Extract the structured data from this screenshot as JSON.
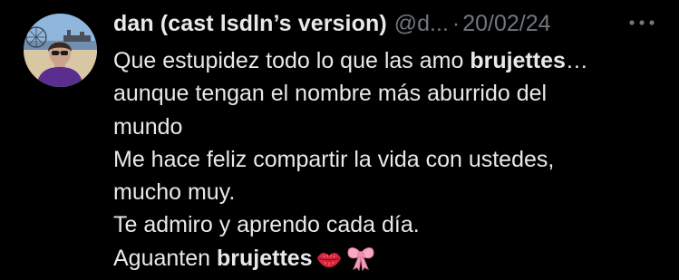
{
  "tweet": {
    "display_name": "dan (cast lsdln’s version)",
    "handle": "@d...",
    "separator": "·",
    "date": "20/02/24",
    "more_icon": "more-horizontal-icon",
    "avatar_icon": "profile-photo",
    "lines": [
      {
        "parts": [
          {
            "text": "Que estupidez todo lo que las amo ",
            "bold": false
          },
          {
            "text": "brujettes",
            "bold": true
          },
          {
            "text": "…",
            "bold": false
          }
        ]
      },
      {
        "parts": [
          {
            "text": "aunque tengan el nombre más aburrido del",
            "bold": false
          }
        ]
      },
      {
        "parts": [
          {
            "text": "mundo",
            "bold": false
          }
        ]
      },
      {
        "parts": [
          {
            "text": "Me hace feliz compartir la vida con ustedes,",
            "bold": false
          }
        ]
      },
      {
        "parts": [
          {
            "text": "mucho muy.",
            "bold": false
          }
        ]
      },
      {
        "parts": [
          {
            "text": "Te admiro y aprendo cada día.",
            "bold": false
          }
        ]
      },
      {
        "parts": [
          {
            "text": "Aguanten ",
            "bold": false
          },
          {
            "text": "brujettes",
            "bold": true
          }
        ]
      }
    ],
    "trailing_emojis": [
      "lips-kiss-icon",
      "pink-bow-icon"
    ],
    "colors": {
      "background": "#000000",
      "primary_text": "#e7e9ea",
      "secondary_text": "#71767b",
      "kiss_red": "#d8253c",
      "bow_pink": "#f7a9c4"
    }
  }
}
